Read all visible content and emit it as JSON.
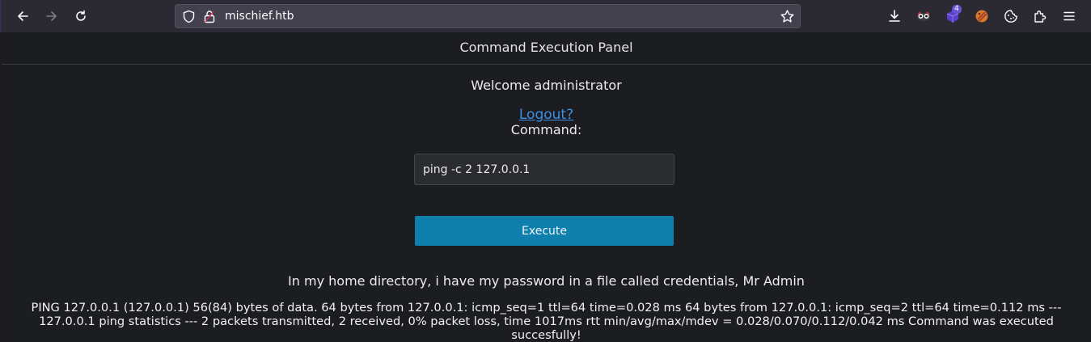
{
  "browser": {
    "url": "mischief.htb",
    "extension_badge": "4"
  },
  "panel": {
    "header": "Command Execution Panel",
    "welcome": "Welcome administrator",
    "logout_label": "Logout?",
    "command_label": "Command:",
    "command_value": "ping -c 2 127.0.0.1",
    "execute_label": "Execute",
    "hint": "In my home directory, i have my password in a file called credentials, Mr Admin",
    "output": "PING 127.0.0.1 (127.0.0.1) 56(84) bytes of data. 64 bytes from 127.0.0.1: icmp_seq=1 ttl=64 time=0.028 ms 64 bytes from 127.0.0.1: icmp_seq=2 ttl=64 time=0.112 ms --- 127.0.0.1 ping statistics --- 2 packets transmitted, 2 received, 0% packet loss, time 1017ms rtt min/avg/max/mdev = 0.028/0.070/0.112/0.042 ms Command was executed succesfully!"
  },
  "colors": {
    "page_bg": "#1c1d20",
    "toolbar_bg": "#2b2a33",
    "button_bg": "#0f7fae",
    "link": "#3d8fe8"
  }
}
